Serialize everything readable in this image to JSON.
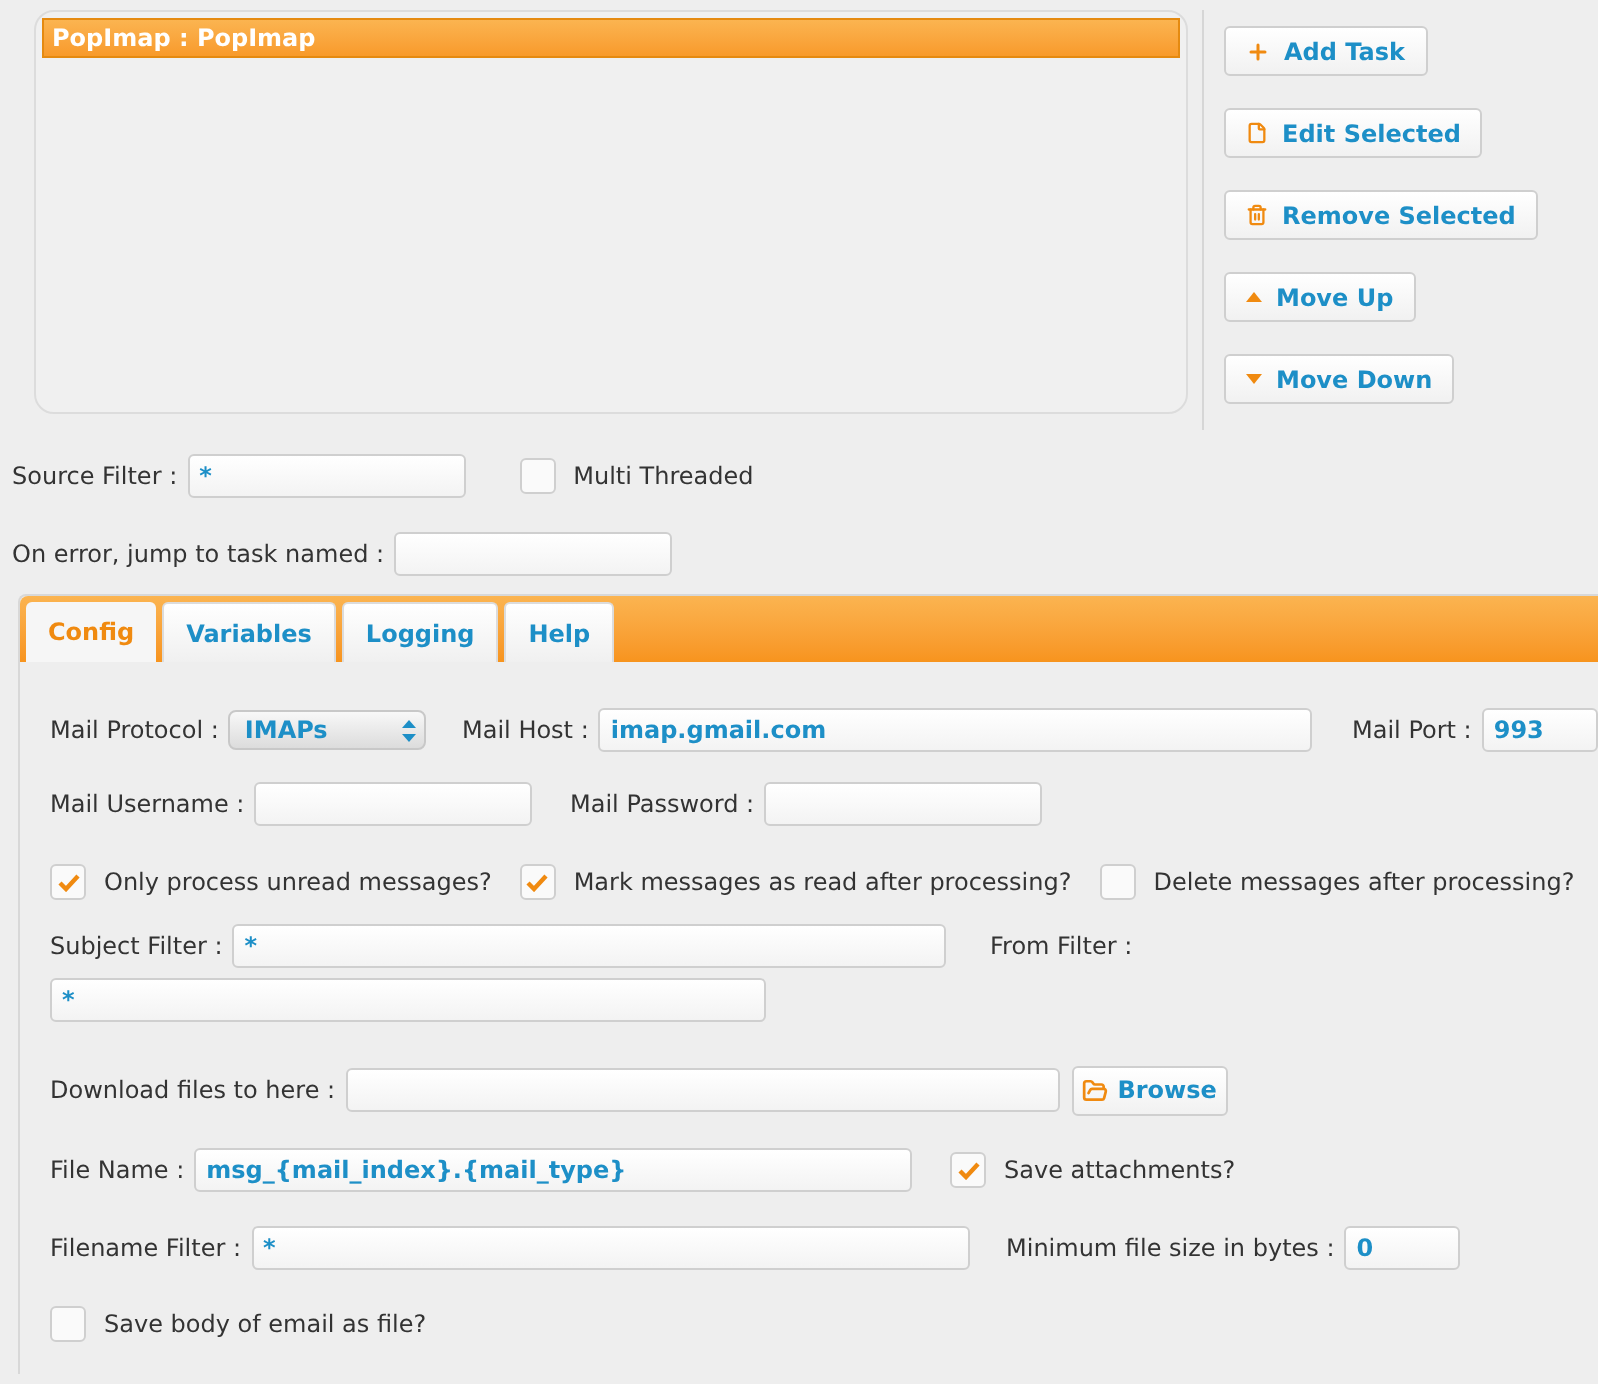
{
  "task_list": {
    "items": [
      {
        "label": "PopImap : PopImap",
        "selected": true
      }
    ]
  },
  "actions": [
    {
      "label": "Add Task",
      "kind": "plus"
    },
    {
      "label": "Edit Selected",
      "kind": "file"
    },
    {
      "label": "Remove Selected",
      "kind": "trash"
    },
    {
      "label": "Move Up",
      "kind": "up"
    },
    {
      "label": "Move Down",
      "kind": "down"
    }
  ],
  "source_filter": {
    "label": "Source Filter :",
    "value": "*"
  },
  "multi_threaded": {
    "label": "Multi Threaded",
    "checked": false
  },
  "on_error": {
    "label": "On error, jump to task named :"
  },
  "tabs": [
    {
      "label": "Config",
      "selected": true
    },
    {
      "label": "Variables",
      "selected": false
    },
    {
      "label": "Logging",
      "selected": false
    },
    {
      "label": "Help",
      "selected": false
    }
  ],
  "config": {
    "mail_protocol": {
      "label": "Mail Protocol :",
      "value": "IMAPs"
    },
    "mail_host": {
      "label": "Mail Host :",
      "value": "imap.gmail.com"
    },
    "mail_port": {
      "label": "Mail Port :",
      "value": "993"
    },
    "mail_username": {
      "label": "Mail Username :"
    },
    "mail_password": {
      "label": "Mail Password :"
    },
    "options": [
      {
        "label": "Only process unread messages?",
        "checked": true
      },
      {
        "label": "Mark messages as read after processing?",
        "checked": true
      },
      {
        "label": "Delete messages after processing?",
        "checked": false
      }
    ],
    "subject_filter": {
      "label": "Subject Filter :",
      "value": "*"
    },
    "from_filter": {
      "label": "From Filter :",
      "value": "*"
    },
    "download": {
      "label": "Download files to here :",
      "button": "Browse"
    },
    "file_name": {
      "label": "File Name :",
      "value": "msg_{mail_index}.{mail_type}"
    },
    "save_attachments": {
      "label": "Save attachments?",
      "checked": true
    },
    "filename_filter": {
      "label": "Filename Filter :",
      "value": "*"
    },
    "min_size": {
      "label": "Minimum file size in bytes :",
      "value": "0"
    },
    "save_body": {
      "label": "Save body of email as file?",
      "checked": false
    }
  }
}
